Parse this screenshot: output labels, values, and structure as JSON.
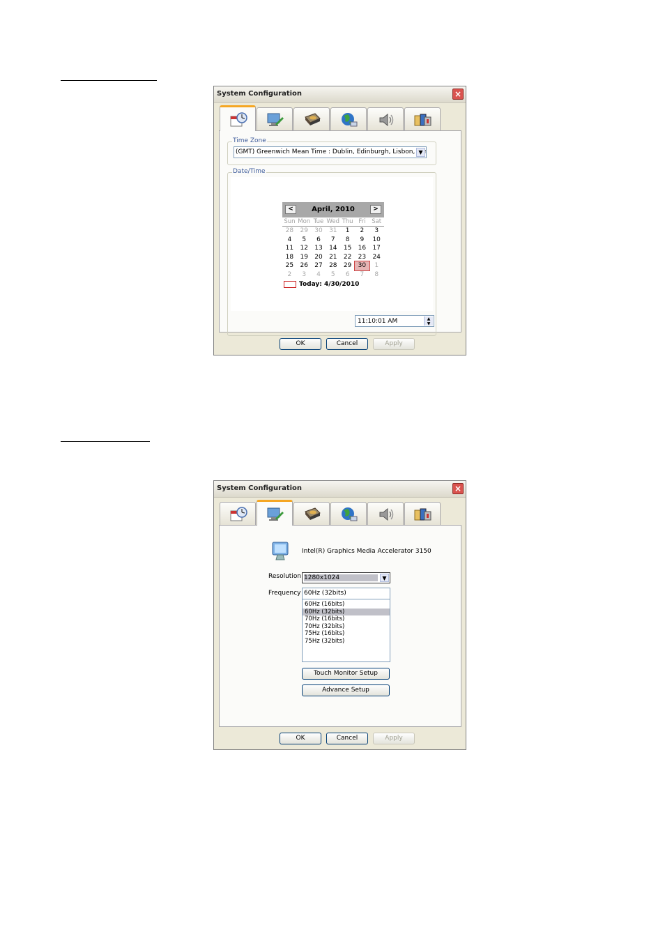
{
  "dialog_title": "System Configuration",
  "close_glyph": "×",
  "tabs": [
    {
      "icon": "clock-calendar-icon"
    },
    {
      "icon": "display-settings-icon"
    },
    {
      "icon": "hard-drive-icon"
    },
    {
      "icon": "network-globe-icon"
    },
    {
      "icon": "speaker-icon"
    },
    {
      "icon": "system-info-icon"
    }
  ],
  "datetime_page": {
    "timezone_legend": "Time Zone",
    "timezone_value": "(GMT) Greenwich Mean Time : Dublin, Edinburgh, Lisbon, London",
    "datetime_legend": "Date/Time",
    "calendar": {
      "month_label": "April, 2010",
      "prev_glyph": "<",
      "next_glyph": ">",
      "weekdays": [
        "Sun",
        "Mon",
        "Tue",
        "Wed",
        "Thu",
        "Fri",
        "Sat"
      ],
      "weeks": [
        [
          "28",
          "29",
          "30",
          "31",
          "1",
          "2",
          "3"
        ],
        [
          "4",
          "5",
          "6",
          "7",
          "8",
          "9",
          "10"
        ],
        [
          "11",
          "12",
          "13",
          "14",
          "15",
          "16",
          "17"
        ],
        [
          "18",
          "19",
          "20",
          "21",
          "22",
          "23",
          "24"
        ],
        [
          "25",
          "26",
          "27",
          "28",
          "29",
          "30",
          "1"
        ],
        [
          "2",
          "3",
          "4",
          "5",
          "6",
          "7",
          "8"
        ]
      ],
      "selected_day": "30",
      "today_label": "Today: 4/30/2010"
    },
    "time_value": "11:10:01 AM"
  },
  "display_page": {
    "adapter_name": "Intel(R) Graphics Media Accelerator 3150",
    "resolution_label": "Resolution",
    "resolution_value": "1280x1024",
    "frequency_label": "Frequency",
    "frequency_value": "60Hz (32bits)",
    "frequency_options": [
      "60Hz (16bits)",
      "60Hz (32bits)",
      "70Hz (16bits)",
      "70Hz (32bits)",
      "75Hz (16bits)",
      "75Hz (32bits)"
    ],
    "selected_option_index": 1,
    "touch_button": "Touch Monitor Setup",
    "advance_button": "Advance Setup"
  },
  "buttons": {
    "ok": "OK",
    "cancel": "Cancel",
    "apply": "Apply"
  },
  "colors": {
    "active_tab_accent": "#f5a623",
    "close_button": "#d9534f",
    "dialog_face": "#ece9d8"
  }
}
